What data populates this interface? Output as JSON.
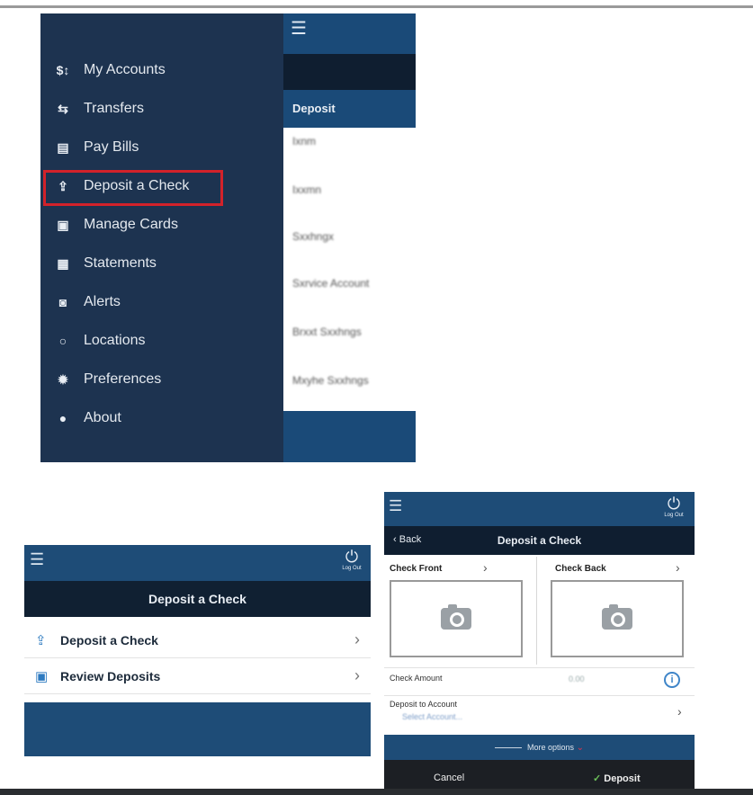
{
  "side_menu": {
    "items": [
      {
        "icon": "$↕",
        "label": "My Accounts"
      },
      {
        "icon": "⇆",
        "label": "Transfers"
      },
      {
        "icon": "▤",
        "label": "Pay Bills"
      },
      {
        "icon": "⇪",
        "label": "Deposit a Check"
      },
      {
        "icon": "▣",
        "label": "Manage Cards"
      },
      {
        "icon": "▦",
        "label": "Statements"
      },
      {
        "icon": "◙",
        "label": "Alerts"
      },
      {
        "icon": "○",
        "label": "Locations"
      },
      {
        "icon": "✹",
        "label": "Preferences"
      },
      {
        "icon": "●",
        "label": "About"
      }
    ],
    "highlighted": "Deposit a Check",
    "highlight_color": "#d3222a",
    "panel_title": "Deposit",
    "panel_items": [
      "Ixnm",
      "Ixxmn",
      "Sxxhngx",
      "Sxrvice Account",
      "Brxxt Sxxhngs",
      "Mxyhe Sxxhngs"
    ]
  },
  "deposit_menu": {
    "logout": "Log Out",
    "title": "Deposit a Check",
    "rows": [
      {
        "icon": "deposit-check-icon",
        "label": "Deposit a Check"
      },
      {
        "icon": "review-deposits-icon",
        "label": "Review Deposits"
      }
    ]
  },
  "deposit_form": {
    "logout": "Log Out",
    "back": "Back",
    "title": "Deposit a Check",
    "check_front": "Check Front",
    "check_back": "Check Back",
    "check_amount": "Check Amount",
    "amount_placeholder": "0.00",
    "deposit_to_account": "Deposit to Account",
    "account_placeholder": "Select Account...",
    "more_options": "More options",
    "cancel": "Cancel",
    "deposit": "Deposit"
  },
  "colors": {
    "navy": "#1d3350",
    "header_blue": "#1e4c77",
    "dark_bar": "#0f1e30",
    "accent": "#3f85c8"
  }
}
